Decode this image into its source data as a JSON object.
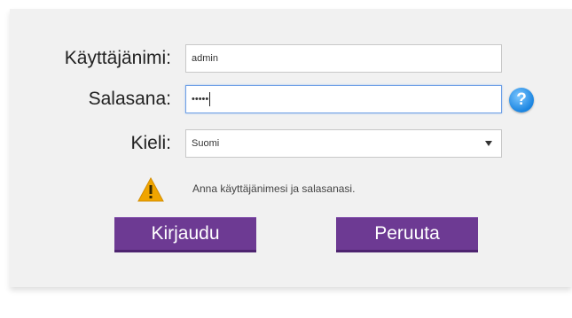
{
  "form": {
    "username": {
      "label": "Käyttäjänimi:",
      "value": "admin"
    },
    "password": {
      "label": "Salasana:",
      "value": "•••••"
    },
    "language": {
      "label": "Kieli:",
      "selected": "Suomi"
    },
    "message": "Anna käyttäjänimesi ja salasanasi.",
    "login_label": "Kirjaudu",
    "cancel_label": "Peruuta"
  },
  "icons": {
    "help": "help-icon",
    "warning": "warning-icon",
    "dropdown": "chevron-down-icon"
  },
  "colors": {
    "button": "#6d3a93",
    "help": "#1a84e0",
    "warning": "#f0a500",
    "panel": "#f1f1f1",
    "focus_border": "#6fa0e6"
  }
}
